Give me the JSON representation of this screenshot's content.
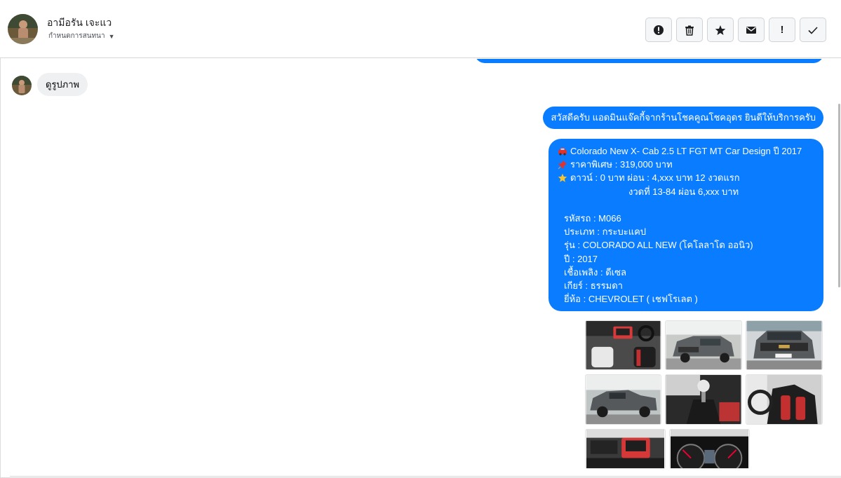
{
  "header": {
    "contact_name": "อามีอรัน เจะแว",
    "conversation_label": "กำหนดการสนทนา",
    "avatar_icon": "user-avatar-photo",
    "toolbar": [
      {
        "name": "report-icon",
        "label": "รายงาน"
      },
      {
        "name": "trash-icon",
        "label": "ลบ"
      },
      {
        "name": "star-icon",
        "label": "ติดดาว"
      },
      {
        "name": "envelope-icon",
        "label": "ยังไม่ได้อ่าน"
      },
      {
        "name": "exclamation-icon",
        "label": "สแปม"
      },
      {
        "name": "check-icon",
        "label": "เสร็จสิ้น"
      }
    ]
  },
  "messages": {
    "incoming_1": "ดูรูปภาพ",
    "outgoing_greeting": "สวัสดีครับ แอดมินแจ๊คกี้จากร้านโชคคูณโชคอุดร ยินดีให้บริการครับ",
    "detail": {
      "title": "Colorado New X- Cab 2.5 LT FGT MT Car Design ปี 2017",
      "price": "ราคาพิเศษ : 319,000 บาท",
      "down": "ดาวน์ : 0 บาท ผ่อน : 4,xxx บาท 12 งวดแรก",
      "installment": "งวดที่ 13-84 ผ่อน 6,xxx บาท",
      "code": "รหัสรถ : M066",
      "type": "ประเภท : กระบะแคป",
      "model": "รุ่น : COLORADO ALL NEW (โคโลลาโด ออนิว)",
      "year": "ปี : 2017",
      "fuel": "เชื้อเพลิง : ดีเซล",
      "gear": "เกียร์ : ธรรมดา",
      "brand": "ยี่ห้อ : CHEVROLET ( เชฟโรเลต )"
    },
    "emoji_icons": [
      "car-icon",
      "pushpin-icon",
      "star-icon"
    ]
  },
  "photos": [
    {
      "name": "photo-interior-dashboard"
    },
    {
      "name": "photo-exterior-front-angle"
    },
    {
      "name": "photo-exterior-front"
    },
    {
      "name": "photo-exterior-side"
    },
    {
      "name": "photo-gear-shifter"
    },
    {
      "name": "photo-interior-seats"
    },
    {
      "name": "photo-interior-console"
    },
    {
      "name": "photo-gauge-cluster"
    }
  ],
  "colors": {
    "outgoing_bubble": "#0a7cff",
    "incoming_bubble": "#eef0f2"
  }
}
